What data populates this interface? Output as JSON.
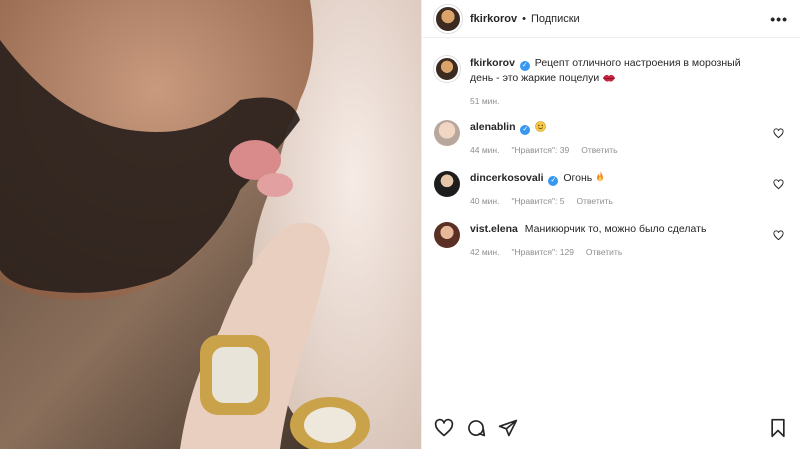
{
  "post": {
    "author": "fkirkorov",
    "follow_label": "Подписки",
    "more_label": "•••",
    "caption": "Рецепт отличного настроения в морозный день - это жаркие поцелуи",
    "caption_time": "51 мин."
  },
  "comments": [
    {
      "user": "alenablin",
      "text": "",
      "emoji": "smiling-face",
      "time": "44 мин.",
      "likes": "\"Нравится\": 39",
      "reply": "Ответить"
    },
    {
      "user": "dincerkosovali",
      "text": "Огонь",
      "emoji": "fire",
      "time": "40 мин.",
      "likes": "\"Нравится\": 5",
      "reply": "Ответить"
    },
    {
      "user": "vist.elena",
      "text": "Маникюрчик то, можно было сделать",
      "emoji": "",
      "time": "42 мин.",
      "likes": "\"Нравится\": 129",
      "reply": "Ответить"
    }
  ],
  "icons": {
    "like": "heart-icon",
    "comment": "comment-icon",
    "share": "share-icon",
    "save": "bookmark-icon",
    "lips": "kiss-lips-icon",
    "verified": "verified-badge-icon"
  },
  "colors": {
    "verified": "#3897f0",
    "meta": "#8e8e8e",
    "lips": "#c4243c"
  }
}
